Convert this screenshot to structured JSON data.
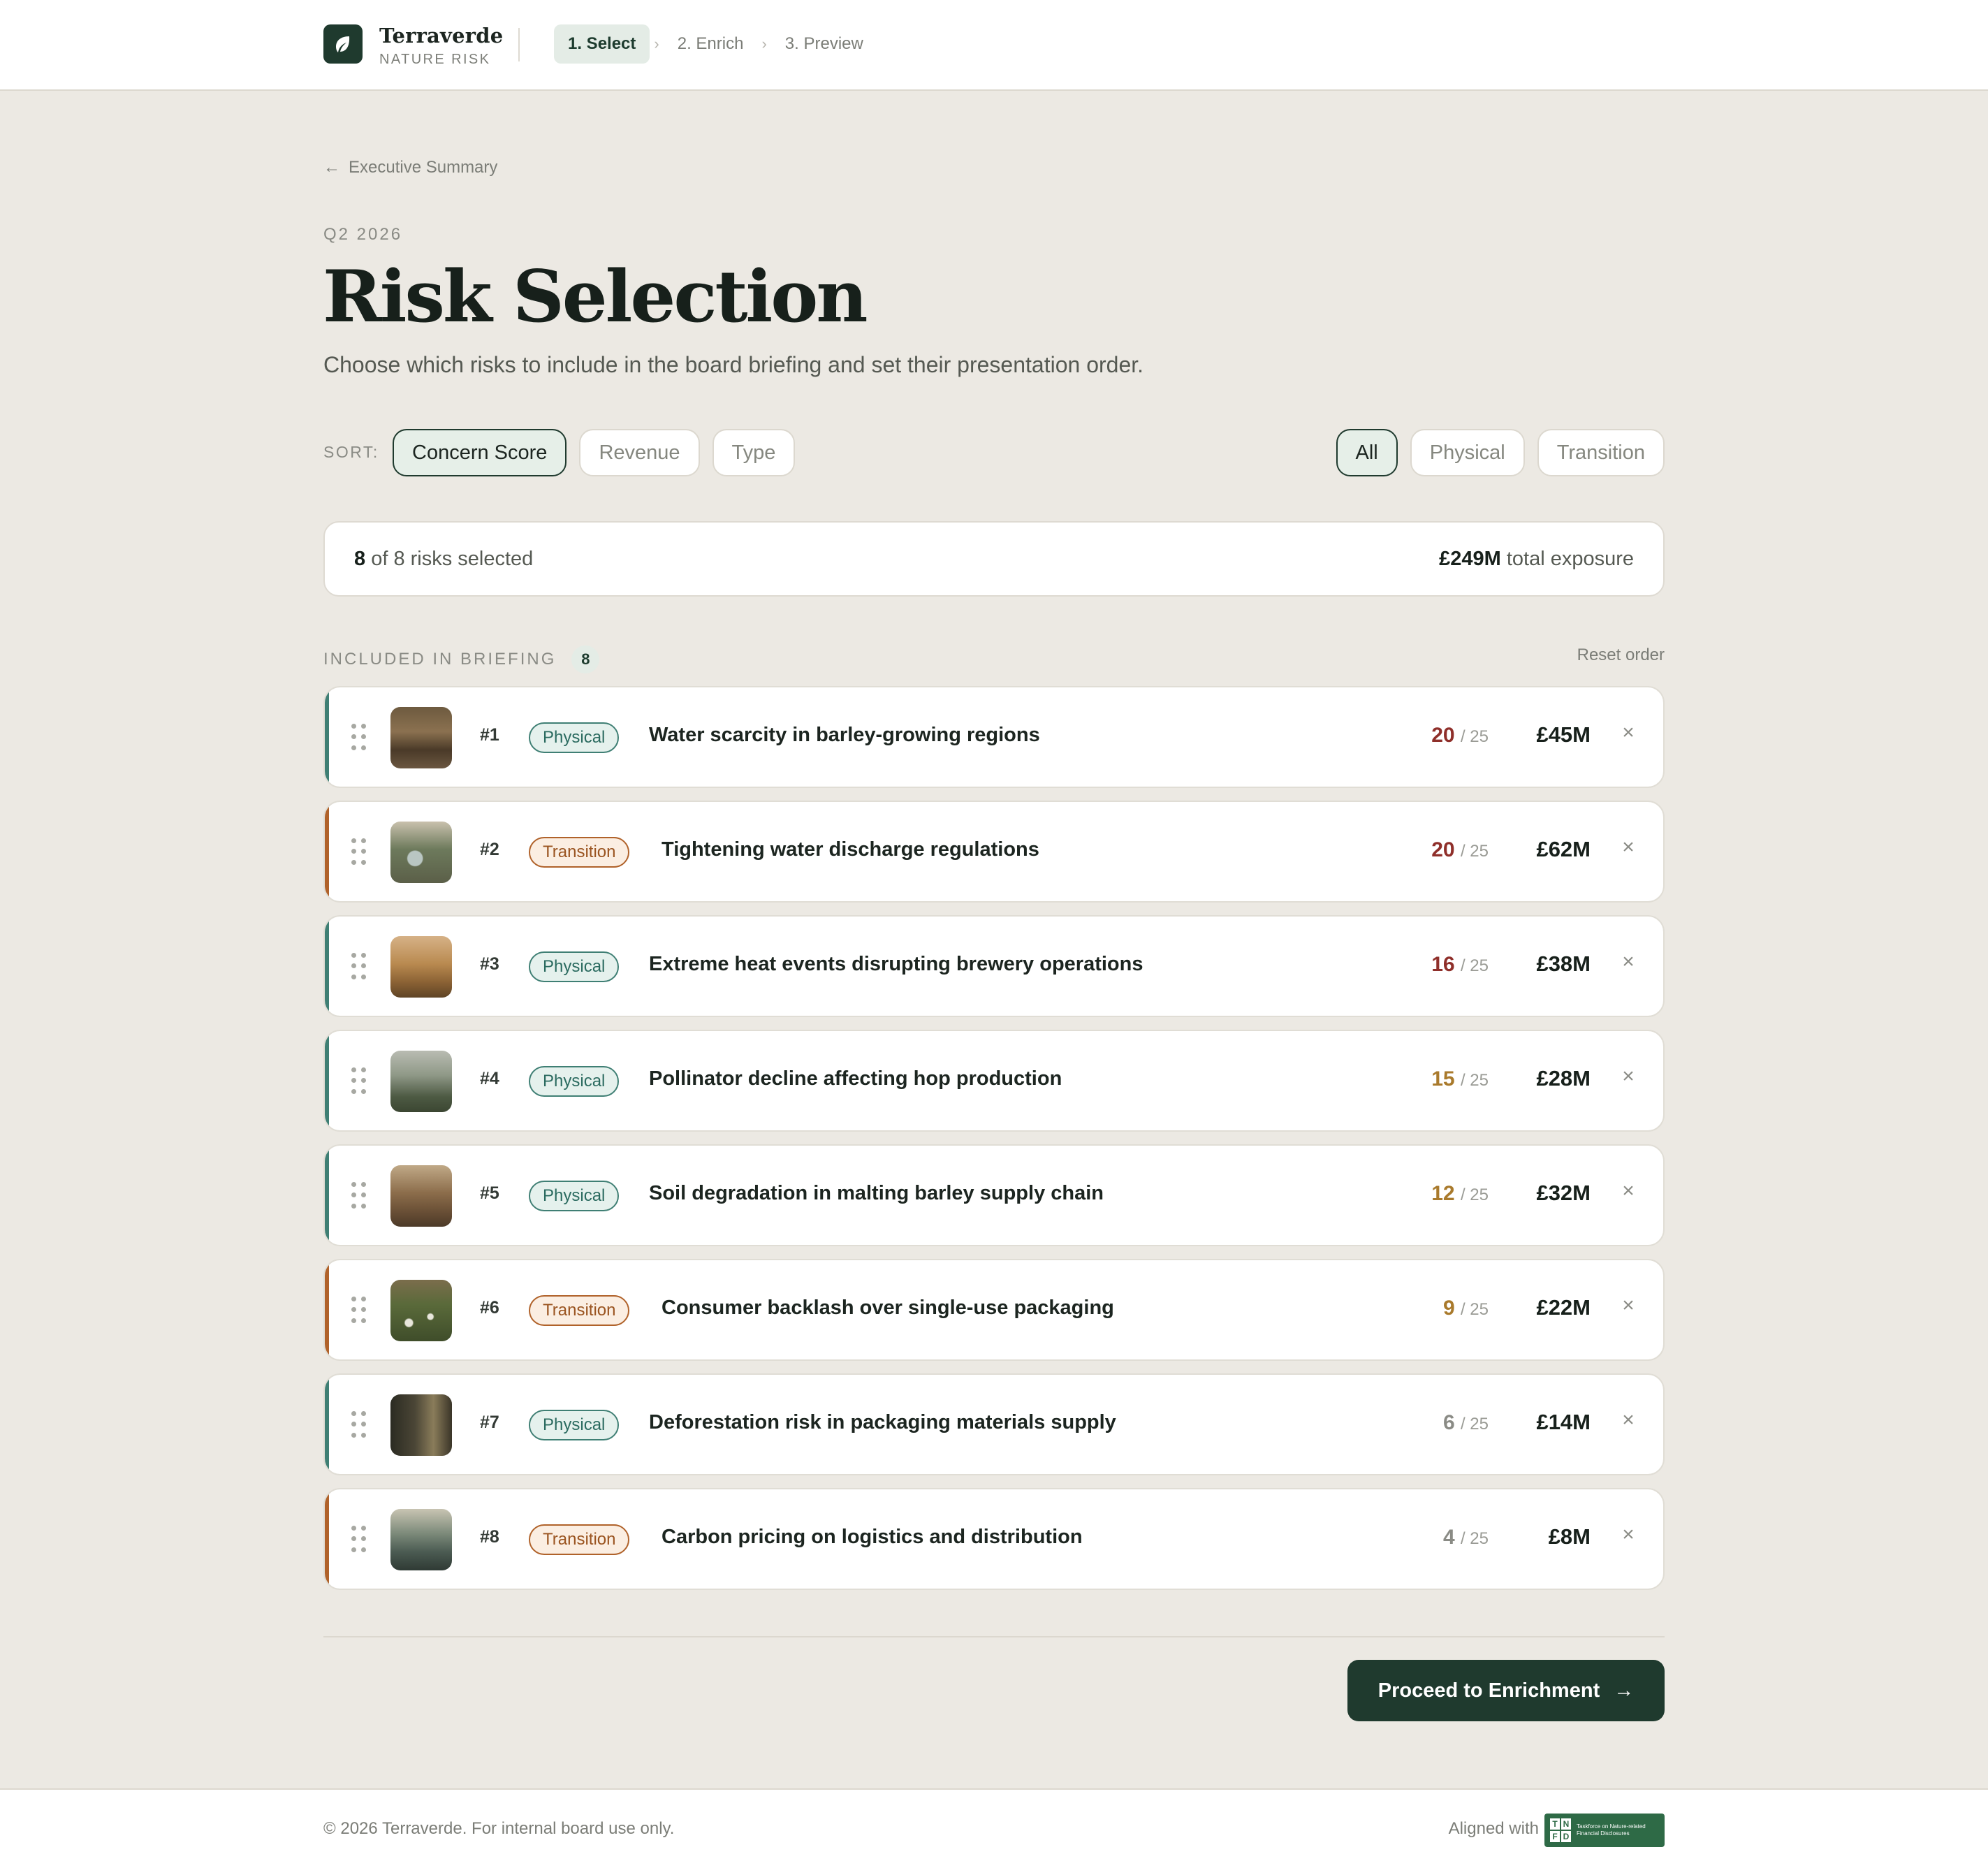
{
  "header": {
    "brand_name": "Terraverde",
    "brand_sub": "NATURE RISK",
    "steps": [
      {
        "label": "1. Select",
        "active": true
      },
      {
        "label": "2. Enrich",
        "active": false
      },
      {
        "label": "3. Preview",
        "active": false
      }
    ],
    "step_separator": "›"
  },
  "main": {
    "back_link": "Executive Summary",
    "back_icon": "←",
    "eyebrow": "Q2 2026",
    "title": "Risk Selection",
    "subtitle": "Choose which risks to include in the board briefing and set their presentation order.",
    "sort_label": "SORT:",
    "sort_options": [
      "Concern Score",
      "Revenue",
      "Type"
    ],
    "sort_active": "Concern Score",
    "filter_options": [
      "All",
      "Physical",
      "Transition"
    ],
    "filter_active": "All",
    "summary": {
      "selected_count": "8",
      "selected_rest": "of 8 risks selected",
      "exposure_value": "£249M",
      "exposure_rest": "total exposure"
    },
    "section_label": "INCLUDED IN BRIEFING",
    "section_count": "8",
    "reset_label": "Reset order",
    "proceed_label": "Proceed to Enrichment",
    "proceed_icon": "→"
  },
  "risks": [
    {
      "rank": "#1",
      "type": "Physical",
      "title": "Water scarcity in barley-growing regions",
      "score": "20",
      "score_max": "/ 25",
      "score_level": "high",
      "amount": "£45M",
      "thumb": "dry-field"
    },
    {
      "rank": "#2",
      "type": "Transition",
      "title": "Tightening water discharge regulations",
      "score": "20",
      "score_max": "/ 25",
      "score_level": "high",
      "amount": "£62M",
      "thumb": "river-bend"
    },
    {
      "rank": "#3",
      "type": "Physical",
      "title": "Extreme heat events disrupting brewery operations",
      "score": "16",
      "score_max": "/ 25",
      "score_level": "high",
      "amount": "£38M",
      "thumb": "golden-field"
    },
    {
      "rank": "#4",
      "type": "Physical",
      "title": "Pollinator decline affecting hop production",
      "score": "15",
      "score_max": "/ 25",
      "score_level": "mid",
      "amount": "£28M",
      "thumb": "misty-plants"
    },
    {
      "rank": "#5",
      "type": "Physical",
      "title": "Soil degradation in malting barley supply chain",
      "score": "12",
      "score_max": "/ 25",
      "score_level": "mid",
      "amount": "£32M",
      "thumb": "soil"
    },
    {
      "rank": "#6",
      "type": "Transition",
      "title": "Consumer backlash over single-use packaging",
      "score": "9",
      "score_max": "/ 25",
      "score_level": "mid",
      "amount": "£22M",
      "thumb": "meadow"
    },
    {
      "rank": "#7",
      "type": "Physical",
      "title": "Deforestation risk in packaging materials supply",
      "score": "6",
      "score_max": "/ 25",
      "score_level": "low",
      "amount": "£14M",
      "thumb": "forest"
    },
    {
      "rank": "#8",
      "type": "Transition",
      "title": "Carbon pricing on logistics and distribution",
      "score": "4",
      "score_max": "/ 25",
      "score_level": "low",
      "amount": "£8M",
      "thumb": "road"
    }
  ],
  "footer": {
    "copyright": "© 2026 Terraverde. For internal board use only.",
    "aligned_label": "Aligned with",
    "tnfd_letters": [
      "T",
      "N",
      "F",
      "D"
    ],
    "tnfd_text": "Taskforce on Nature-related Financial Disclosures"
  },
  "colors": {
    "brand": "#1f3a2e",
    "physical": "#3f7f74",
    "transition": "#b0622a",
    "score_high": "#8f2f2a",
    "score_mid": "#a97a2c",
    "score_low": "#8a8b85",
    "background": "#ece9e3"
  },
  "icons": {
    "brand": "leaf-icon",
    "drag": "drag-handle-icon",
    "remove": "close-icon",
    "back": "arrow-left-icon",
    "proceed": "arrow-right-icon"
  }
}
